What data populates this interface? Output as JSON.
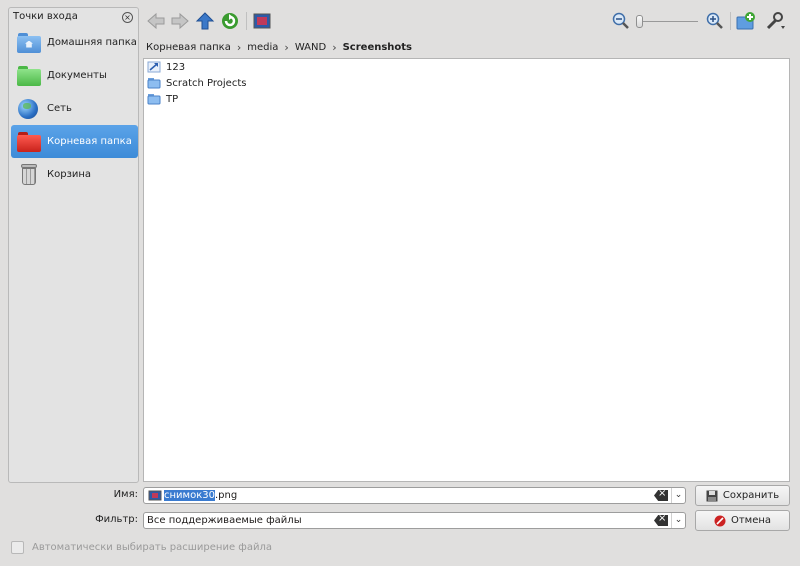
{
  "sidebar": {
    "title": "Точки входа",
    "items": [
      {
        "label": "Домашняя папка",
        "icon": "home-folder-icon"
      },
      {
        "label": "Документы",
        "icon": "documents-folder-icon"
      },
      {
        "label": "Сеть",
        "icon": "network-globe-icon"
      },
      {
        "label": "Корневая папка",
        "icon": "root-folder-icon",
        "selected": true
      },
      {
        "label": "Корзина",
        "icon": "trash-icon"
      }
    ]
  },
  "breadcrumb": {
    "items": [
      "Корневая папка",
      "media",
      "WAND",
      "Screenshots"
    ]
  },
  "files": [
    {
      "name": "123",
      "icon": "link-icon"
    },
    {
      "name": "Scratch Projects",
      "icon": "folder-icon"
    },
    {
      "name": "TP",
      "icon": "folder-icon"
    }
  ],
  "form": {
    "name_label": "Имя:",
    "name_selected": "снимок30",
    "name_rest": ".png",
    "filter_label": "Фильтр:",
    "filter_value": "Все поддерживаемые файлы",
    "save_label": "Сохранить",
    "cancel_label": "Отмена",
    "auto_ext_label": "Автоматически выбирать расширение файла"
  },
  "colors": {
    "selection": "#3d8bd8",
    "home_folder": "#6aa7e8",
    "documents_folder": "#6fd06a",
    "root_folder": "#e2342c",
    "cancel_red": "#cc2222"
  }
}
